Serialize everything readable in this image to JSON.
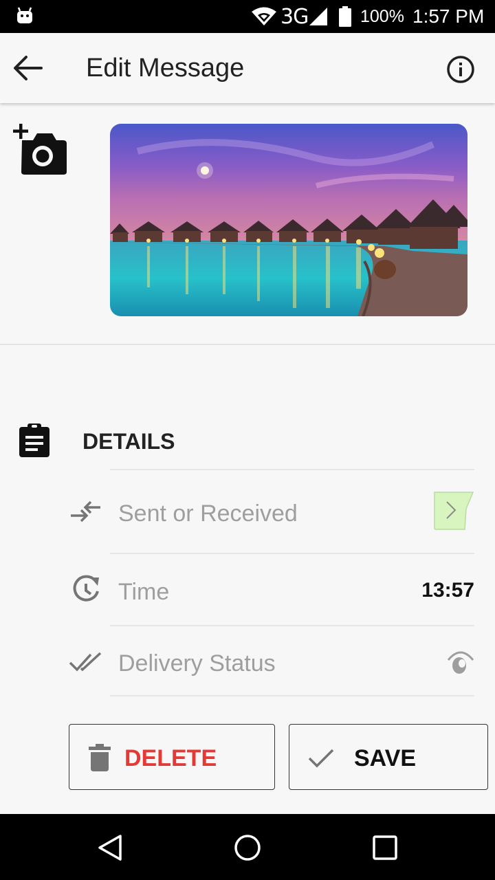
{
  "status_bar": {
    "network_type": "3G",
    "battery_percent": "100%",
    "time": "1:57 PM"
  },
  "app_bar": {
    "title": "Edit Message",
    "back_icon": "arrow-left-icon",
    "info_icon": "info-icon"
  },
  "media": {
    "add_photo_icon": "add-a-photo-icon",
    "image_description_icon": "photo"
  },
  "details": {
    "section_title": "DETAILS",
    "rows": [
      {
        "label": "Sent or Received",
        "value": "",
        "icon": "sent-received-arrows-icon"
      },
      {
        "label": "Time",
        "value": "13:57",
        "icon": "clock-icon"
      },
      {
        "label": "Delivery Status",
        "value": "",
        "icon": "double-check-icon"
      }
    ]
  },
  "actions": {
    "delete_label": "DELETE",
    "save_label": "SAVE"
  },
  "colors": {
    "delete_red": "#e53935",
    "chevron_bubble": "#d8f5c0",
    "background": "#f7f7f7"
  }
}
